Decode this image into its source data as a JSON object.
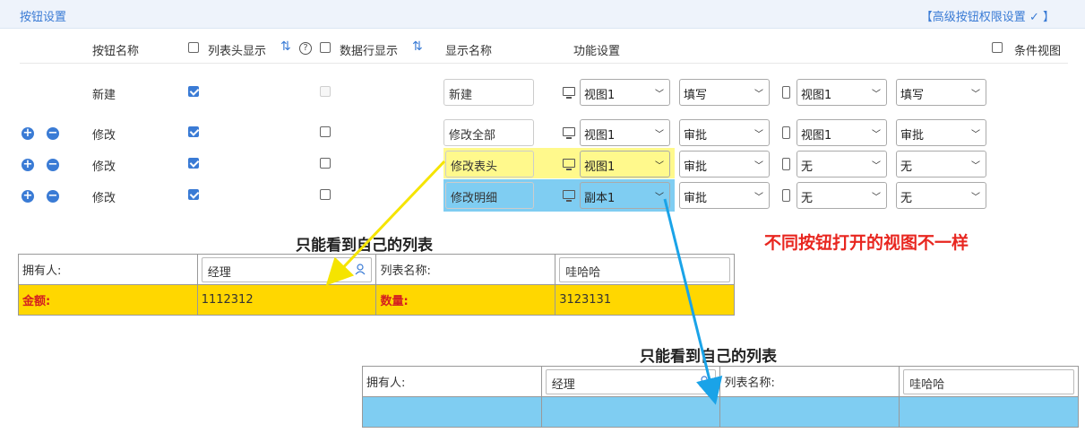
{
  "header": {
    "title": "按钮设置",
    "advanced_link": "【高级按钮权限设置",
    "advanced_link_end": "】",
    "check_mark": "✓"
  },
  "columns": {
    "button_name": "按钮名称",
    "list_header_display": "列表头显示",
    "data_row_display": "数据行显示",
    "display_name": "显示名称",
    "function_settings": "功能设置",
    "condition_view": "条件视图"
  },
  "rows": [
    {
      "name": "新建",
      "list_header": true,
      "data_row": false,
      "data_row_disabled": true,
      "display_name": "新建",
      "pc_view": "视图1",
      "pc_mode": "填写",
      "mobile_view": "视图1",
      "mobile_mode": "填写"
    },
    {
      "name": "修改",
      "list_header": true,
      "data_row": false,
      "display_name": "修改全部",
      "pc_view": "视图1",
      "pc_mode": "审批",
      "mobile_view": "视图1",
      "mobile_mode": "审批"
    },
    {
      "name": "修改",
      "list_header": true,
      "data_row": false,
      "display_name": "修改表头",
      "pc_view": "视图1",
      "pc_mode": "审批",
      "mobile_view": "无",
      "mobile_mode": "无"
    },
    {
      "name": "修改",
      "list_header": true,
      "data_row": false,
      "display_name": "修改明细",
      "pc_view": "副本1",
      "pc_mode": "审批",
      "mobile_view": "无",
      "mobile_mode": "无"
    }
  ],
  "annotation": {
    "title_left": "只能看到自己的列表",
    "title_right": "只能看到自己的列表",
    "red_note": "不同按钮打开的视图不一样"
  },
  "form_left": {
    "owner_label": "拥有人:",
    "owner_value": "经理",
    "list_name_label": "列表名称:",
    "list_name_value": "哇哈哈",
    "amount_label": "金额:",
    "amount_value": "1112312",
    "qty_label": "数量:",
    "qty_value": "3123131"
  },
  "form_right": {
    "owner_label": "拥有人:",
    "owner_value": "经理",
    "list_name_label": "列表名称:",
    "list_name_value": "哇哈哈"
  },
  "colors": {
    "accent": "#3a7bd5",
    "highlight_yellow": "#fff98c",
    "highlight_blue": "#7fcdf2",
    "form_yellow": "#ffd700",
    "arrow_yellow": "#f5e400",
    "arrow_blue": "#1aa3e8",
    "note_red": "#e8261f"
  }
}
